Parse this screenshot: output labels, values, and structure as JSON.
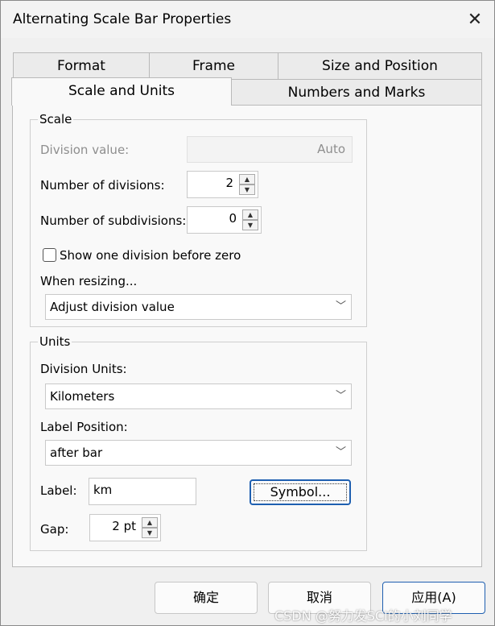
{
  "window": {
    "title": "Alternating Scale Bar Properties",
    "close_glyph": "✕"
  },
  "tabs": {
    "row1": [
      "Format",
      "Frame",
      "Size and Position"
    ],
    "row2": [
      "Scale and Units",
      "Numbers and Marks"
    ],
    "active": "Scale and Units"
  },
  "scale": {
    "group_label": "Scale",
    "division_value_label": "Division value:",
    "division_value": "Auto",
    "num_divisions_label": "Number of divisions:",
    "num_divisions": "2",
    "num_subdivisions_label": "Number of subdivisions:",
    "num_subdivisions": "0",
    "show_before_zero_label": "Show one division before zero",
    "show_before_zero_checked": false,
    "when_resizing_label": "When resizing...",
    "when_resizing_value": "Adjust division value"
  },
  "units": {
    "group_label": "Units",
    "division_units_label": "Division Units:",
    "division_units_value": "Kilometers",
    "label_position_label": "Label Position:",
    "label_position_value": "after bar",
    "label_label": "Label:",
    "label_value": "km",
    "symbol_button": "Symbol...",
    "gap_label": "Gap:",
    "gap_value": "2 pt"
  },
  "footer": {
    "ok": "确定",
    "cancel": "取消",
    "apply": "应用(A)"
  },
  "watermark": "CSDN @努力发SCI的小刘同学",
  "icons": {
    "close": "close-icon",
    "spin_up": "spin-up-icon",
    "spin_down": "spin-down-icon",
    "dropdown": "chevron-down-icon"
  }
}
